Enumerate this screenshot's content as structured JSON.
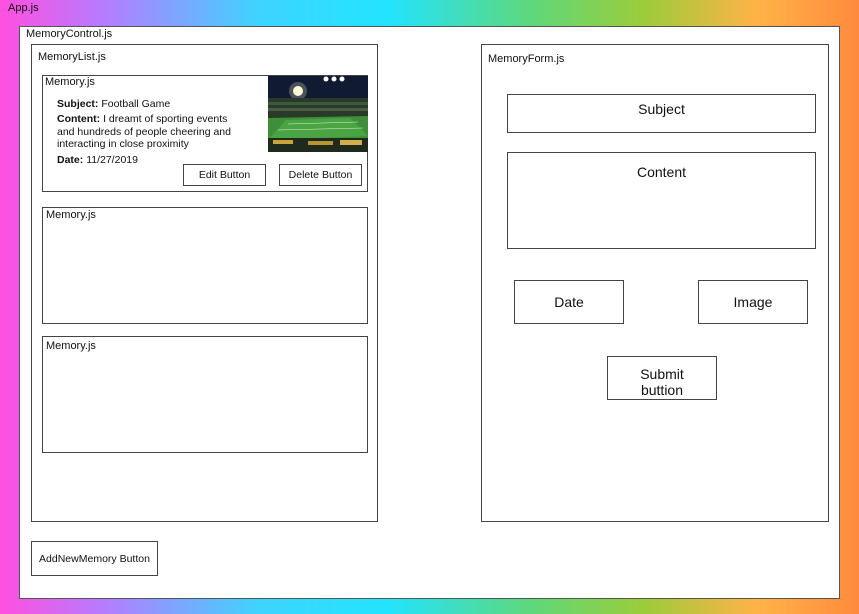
{
  "app": {
    "label": "App.js"
  },
  "memory_control": {
    "label": "MemoryControl.js",
    "add_button": "AddNewMemory Button"
  },
  "memory_list": {
    "label": "MemoryList.js",
    "memories": [
      {
        "label": "Memory.js",
        "subject_key": "Subject:",
        "subject": "Football Game",
        "content_key": "Content:",
        "content_lines": [
          "I dreamt of sporting events",
          "and hundreds of people cheering and",
          "interacting in close proximity"
        ],
        "date_key": "Date:",
        "date": "11/27/2019",
        "edit_button": "Edit Button",
        "delete_button": "Delete Button"
      },
      {
        "label": "Memory.js"
      },
      {
        "label": "Memory.js"
      }
    ]
  },
  "memory_form": {
    "label": "MemoryForm.js",
    "subject": "Subject",
    "content": "Content",
    "date": "Date",
    "image": "Image",
    "submit_lines": [
      "Submit",
      "buttion"
    ]
  }
}
